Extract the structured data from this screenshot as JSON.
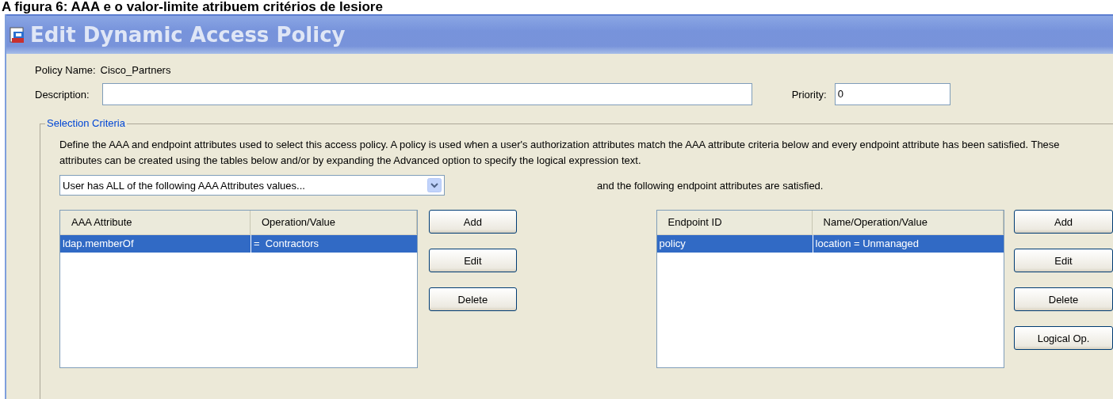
{
  "caption": "A figura 6: AAA e o valor-limite atribuem critérios de lesiore",
  "window": {
    "title": "Edit Dynamic Access Policy"
  },
  "policy_name": {
    "label": "Policy Name:",
    "value": "Cisco_Partners"
  },
  "description": {
    "label": "Description:"
  },
  "priority": {
    "label": "Priority:",
    "value": "0"
  },
  "selection_criteria": {
    "title": "Selection Criteria",
    "text": "Define the AAA and endpoint attributes used to select this access policy. A policy is used when a user's authorization attributes match the AAA attribute criteria below and every endpoint attribute has been satisfied. These attributes can be created using the tables below and/or by expanding the Advanced option to specify the logical expression text.",
    "aaa_match": {
      "value": "User has ALL of the following AAA Attributes values..."
    },
    "endpoint_text": "and the following endpoint attributes are satisfied.",
    "aaa_table": {
      "columns": [
        "AAA Attribute",
        "Operation/Value"
      ],
      "rows": [
        {
          "cells": [
            "ldap.memberOf",
            "=  Contractors"
          ],
          "selected": true
        }
      ]
    },
    "aaa_buttons": [
      "Add",
      "Edit",
      "Delete"
    ],
    "endpoint_table": {
      "columns": [
        "Endpoint ID",
        "Name/Operation/Value"
      ],
      "rows": [
        {
          "cells": [
            "policy",
            "location = Unmanaged"
          ],
          "selected": true
        }
      ]
    },
    "endpoint_buttons": [
      "Add",
      "Edit",
      "Delete",
      "Logical Op."
    ]
  }
}
